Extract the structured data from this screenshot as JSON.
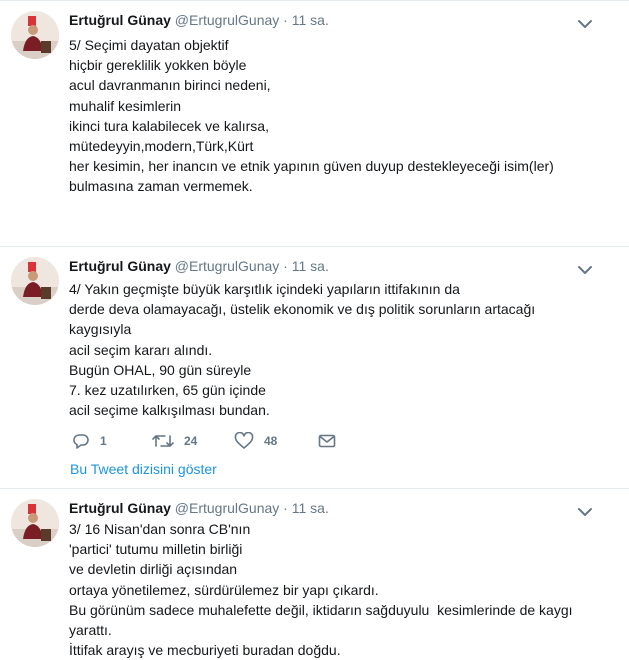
{
  "tweets": [
    {
      "author_name": "Ertuğrul Günay",
      "author_handle": "@ErtugrulGunay",
      "separator": "·",
      "time": "11 sa.",
      "text": "5/ Seçimi dayatan objektif\nhiçbir gereklilik yokken böyle\nacul davranmanın birinci nedeni,\nmuhalif kesimlerin\nikinci tura kalabilecek ve kalırsa,\nmütedeyyin,modern,Türk,Kürt\nher kesimin, her inancın ve etnik yapının güven duyup destekleyeceği isim(ler)\nbulmasına zaman vermemek."
    },
    {
      "author_name": "Ertuğrul Günay",
      "author_handle": "@ErtugrulGunay",
      "separator": "·",
      "time": "11 sa.",
      "text": "4/ Yakın geçmişte büyük karşıtlık içindeki yapıların ittifakının da\nderde deva olamayacağı, üstelik ekonomik ve dış politik sorunların artacağı\nkaygısıyla\nacil seçim kararı alındı.\nBugün OHAL, 90 gün süreyle\n7. kez uzatılırken, 65 gün içinde\nacil seçime kalkışılması bundan.",
      "reply_count": "1",
      "retweet_count": "24",
      "like_count": "48",
      "thread_link": "Bu Tweet dizisini göster"
    },
    {
      "author_name": "Ertuğrul Günay",
      "author_handle": "@ErtugrulGunay",
      "separator": "·",
      "time": "11 sa.",
      "text": "3/ 16 Nisan'dan sonra CB'nın\n'partici' tutumu milletin birliği\nve devletin dirliği açısından\nortaya yönetilemez, sürdürülemez bir yapı çıkardı.\nBu görünüm sadece muhalefette değil, iktidarın sağduyulu  kesimlerinde de kaygı\nyarattı.\nİttifak arayış ve mecburiyeti buradan doğdu."
    }
  ],
  "icons": {
    "caret": "chevron-down-icon",
    "reply": "reply-icon",
    "retweet": "retweet-icon",
    "like": "heart-icon",
    "dm": "envelope-icon"
  },
  "colors": {
    "text": "#14171a",
    "muted": "#657786",
    "link": "#1b95e0",
    "divider": "#e6ecf0"
  }
}
